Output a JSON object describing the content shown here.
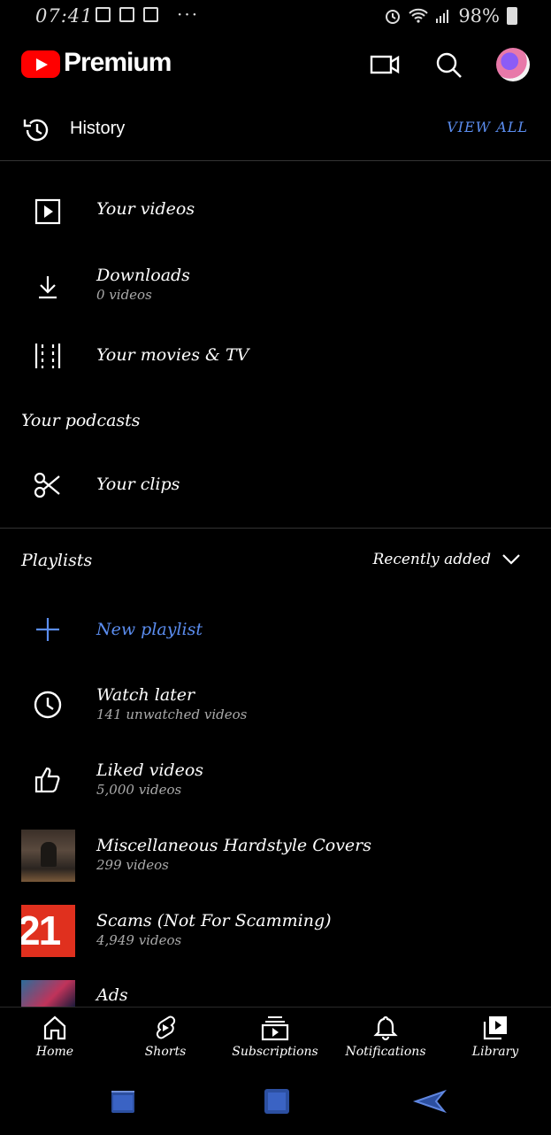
{
  "status": {
    "time": "07:41",
    "dots": "···",
    "battery": "98%"
  },
  "header": {
    "brand": "Premium"
  },
  "history": {
    "label": "History",
    "view_all": "VIEW ALL"
  },
  "library_items": [
    {
      "title": "Your videos",
      "sub": ""
    },
    {
      "title": "Downloads",
      "sub": "0 videos"
    },
    {
      "title": "Your movies & TV",
      "sub": ""
    }
  ],
  "podcasts_label": "Your podcasts",
  "clips_label": "Your clips",
  "playlists": {
    "label": "Playlists",
    "sort": "Recently added",
    "new_playlist": "New playlist",
    "items": [
      {
        "title": "Watch later",
        "sub": "141 unwatched videos"
      },
      {
        "title": "Liked videos",
        "sub": "5,000 videos"
      },
      {
        "title": "Miscellaneous Hardstyle Covers",
        "sub": "299 videos"
      },
      {
        "title": "Scams (Not For Scamming)",
        "sub": "4,949 videos"
      },
      {
        "title": "Ads",
        "sub": ""
      }
    ],
    "thumb_text": "21"
  },
  "nav": [
    {
      "label": "Home",
      "icon": "home-icon"
    },
    {
      "label": "Shorts",
      "icon": "shorts-icon"
    },
    {
      "label": "Subscriptions",
      "icon": "subscriptions-icon"
    },
    {
      "label": "Notifications",
      "icon": "bell-icon"
    },
    {
      "label": "Library",
      "icon": "library-icon"
    }
  ],
  "colors": {
    "accent": "#5b8def",
    "brand_red": "#ff0000",
    "background": "#000000"
  }
}
